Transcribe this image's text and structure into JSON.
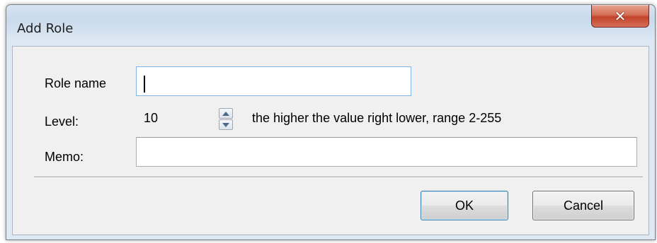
{
  "window": {
    "title": "Add Role",
    "close_glyph": "✕"
  },
  "form": {
    "role_name": {
      "label": "Role name",
      "value": ""
    },
    "level": {
      "label": "Level:",
      "value": "10",
      "hint": "the higher the value right lower, range 2-255"
    },
    "memo": {
      "label": "Memo:",
      "value": ""
    }
  },
  "buttons": {
    "ok_label": "OK",
    "cancel_label": "Cancel"
  },
  "colors": {
    "title_bar": "#c9daec",
    "client_bg": "#f0f0f0",
    "close_button": "#c3432a",
    "focus_border": "#7eb4ea"
  },
  "icons": {
    "close": "close-icon",
    "spin_up": "spin-up-icon",
    "spin_down": "spin-down-icon"
  }
}
